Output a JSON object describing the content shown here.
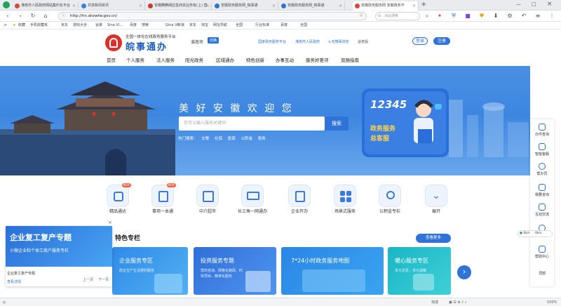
{
  "browser": {
    "tabs": [
      {
        "title": "淮南市人民政府网站集约化平台"
      },
      {
        "title": "共享新闻资讯"
      },
      {
        "title": "安徽腾腾阀应急商贸业务有(上) 营..."
      },
      {
        "title": "安徽政务服务网_皖事通"
      },
      {
        "title": "安徽政务服务网_皖事通"
      },
      {
        "title": "安徽政务服务网 安徽政务平"
      }
    ],
    "url": "http://hn.ahzwfw.gov.cn/",
    "url_search_placeholder": "点此搜索",
    "bookmarks": [
      "收藏",
      "手机收藏夹",
      "京东",
      "游戏大全",
      "谷歌",
      "Sina Vi...",
      "百度",
      "搜索",
      "Gina Vi",
      "新浪",
      "京东",
      "淘宝",
      "网址导航",
      "全国",
      "行业标准",
      "百度",
      "全国"
    ],
    "status_text": "完成",
    "zoom": "100%"
  },
  "header": {
    "logo_subtitle": "全国一体化在线政务服务平台",
    "logo_title": "皖事通办",
    "city": "淮南市",
    "city_switch": "切换",
    "top_links": [
      "国家政务服务平台",
      "淮南市人民政府",
      "无障碍浏览",
      "适老版"
    ],
    "login": "登录",
    "register": "注册"
  },
  "nav": [
    "首页",
    "个人服务",
    "法人服务",
    "阳光政务",
    "区域通办",
    "特色创新",
    "办事互动",
    "服务好差评",
    "双随指南"
  ],
  "banner": {
    "slogan": "美 好 安 徽 欢 迎 您",
    "search_placeholder": "您可以输入服务关键词",
    "search_button": "搜索",
    "hot_label": "热门搜索：",
    "hot_terms": [
      "交警",
      "社保",
      "医保",
      "公积金",
      "税务"
    ],
    "hotline_number": "12345",
    "hotline_title": "政务服务",
    "hotline_subtitle": "总客服"
  },
  "services": [
    {
      "label": "精品通达",
      "badge": "NEW"
    },
    {
      "label": "事项一本通",
      "badge": "NEW"
    },
    {
      "label": "中介超市",
      "badge": ""
    },
    {
      "label": "长三角一网通办",
      "badge": ""
    },
    {
      "label": "企业开办",
      "badge": ""
    },
    {
      "label": "场景式服务",
      "badge": ""
    },
    {
      "label": "公积金专栏",
      "badge": ""
    },
    {
      "label": "展开",
      "badge": ""
    }
  ],
  "section": {
    "title": "特色专栏",
    "more": "查看更多"
  },
  "cards": [
    {
      "title": "企业服务专区",
      "desc": "政企生产生活便利服务"
    },
    {
      "title": "投资服务专题",
      "desc": "营商咨询、网格化施政、时效项目、精准化服务"
    },
    {
      "title": "7*24小时政务服务地图",
      "desc": ""
    },
    {
      "title": "暖心服务专区",
      "desc": "多元关爱、多元温暖"
    }
  ],
  "ad": {
    "headline": "企业复工复产专题",
    "sub": "小微企业和个体工商户服务专栏",
    "caption": "企业复工复产专题",
    "link": "查看详情",
    "prev": "上一页",
    "next": "下一页",
    "close": "×"
  },
  "right_sidebar": [
    "办件查询",
    "智能客服",
    "帮办员",
    "我要咨询",
    "互动交流",
    "用户",
    "帮助中心",
    "顶部"
  ],
  "floating_stats": [
    "0k/s",
    "0k/s"
  ]
}
